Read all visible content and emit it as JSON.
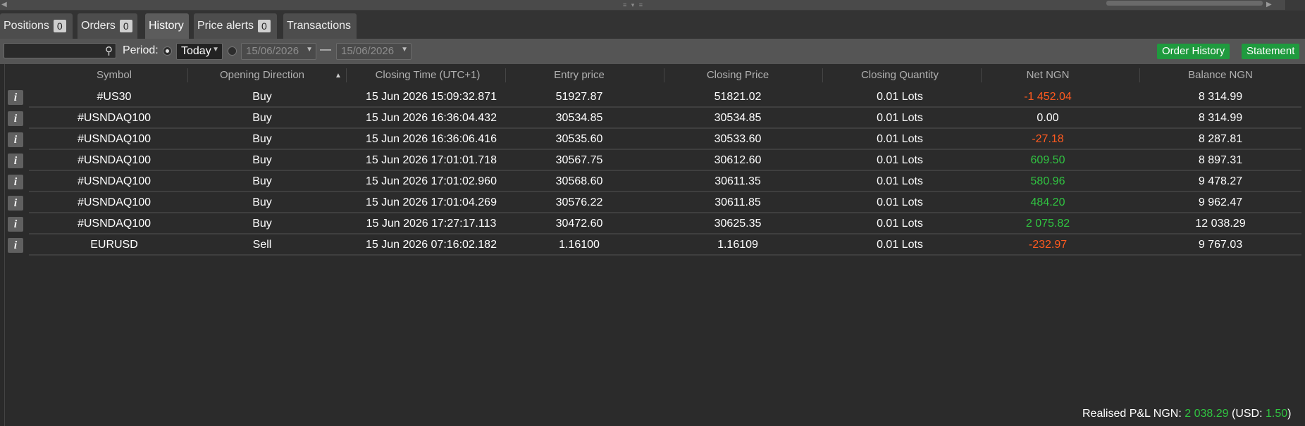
{
  "tabs": [
    {
      "label": "Positions",
      "count": "0"
    },
    {
      "label": "Orders",
      "count": "0"
    },
    {
      "label": "History"
    },
    {
      "label": "Price alerts",
      "count": "0"
    },
    {
      "label": "Transactions"
    }
  ],
  "active_tab": "History",
  "toolbar": {
    "search_placeholder": "",
    "period_label": "Period:",
    "period_value": "Today",
    "date_from": "15/06/2026",
    "date_separator": "—",
    "date_to": "15/06/2026",
    "order_history_label": "Order History",
    "statement_label": "Statement"
  },
  "table": {
    "columns": [
      "Symbol",
      "Opening Direction",
      "Closing Time (UTC+1)",
      "Entry price",
      "Closing Price",
      "Closing Quantity",
      "Net NGN",
      "Balance NGN"
    ],
    "sorted_column": "Opening Direction",
    "rows": [
      {
        "symbol": "#US30",
        "direction": "Buy",
        "closing_time": "15 Jun 2026 15:09:32.871",
        "entry": "51927.87",
        "closing": "51821.02",
        "quantity": "0.01 Lots",
        "net": "-1 452.04",
        "net_sign": "neg",
        "balance": "8 314.99"
      },
      {
        "symbol": "#USNDAQ100",
        "direction": "Buy",
        "closing_time": "15 Jun 2026 16:36:04.432",
        "entry": "30534.85",
        "closing": "30534.85",
        "quantity": "0.01 Lots",
        "net": "0.00",
        "net_sign": "zero",
        "balance": "8 314.99"
      },
      {
        "symbol": "#USNDAQ100",
        "direction": "Buy",
        "closing_time": "15 Jun 2026 16:36:06.416",
        "entry": "30535.60",
        "closing": "30533.60",
        "quantity": "0.01 Lots",
        "net": "-27.18",
        "net_sign": "neg",
        "balance": "8 287.81"
      },
      {
        "symbol": "#USNDAQ100",
        "direction": "Buy",
        "closing_time": "15 Jun 2026 17:01:01.718",
        "entry": "30567.75",
        "closing": "30612.60",
        "quantity": "0.01 Lots",
        "net": "609.50",
        "net_sign": "pos",
        "balance": "8 897.31"
      },
      {
        "symbol": "#USNDAQ100",
        "direction": "Buy",
        "closing_time": "15 Jun 2026 17:01:02.960",
        "entry": "30568.60",
        "closing": "30611.35",
        "quantity": "0.01 Lots",
        "net": "580.96",
        "net_sign": "pos",
        "balance": "9 478.27"
      },
      {
        "symbol": "#USNDAQ100",
        "direction": "Buy",
        "closing_time": "15 Jun 2026 17:01:04.269",
        "entry": "30576.22",
        "closing": "30611.85",
        "quantity": "0.01 Lots",
        "net": "484.20",
        "net_sign": "pos",
        "balance": "9 962.47"
      },
      {
        "symbol": "#USNDAQ100",
        "direction": "Buy",
        "closing_time": "15 Jun 2026 17:27:17.113",
        "entry": "30472.60",
        "closing": "30625.35",
        "quantity": "0.01 Lots",
        "net": "2 075.82",
        "net_sign": "pos",
        "balance": "12 038.29"
      },
      {
        "symbol": "EURUSD",
        "direction": "Sell",
        "closing_time": "15 Jun 2026 07:16:02.182",
        "entry": "1.16100",
        "closing": "1.16109",
        "quantity": "0.01 Lots",
        "net": "-232.97",
        "net_sign": "neg",
        "balance": "9 767.03"
      }
    ],
    "info_glyph": "i"
  },
  "footer": {
    "realised_label": "Realised P&L NGN:",
    "realised_value": "2 038.29",
    "usd_open": "(USD:",
    "usd_value": "1.50",
    "usd_close": ")"
  },
  "colors": {
    "positive": "#30c441",
    "negative": "#ff5a1f",
    "button_green": "#1f9a3e"
  },
  "icons": {
    "search": "search-icon",
    "info": "info-icon",
    "dropdown": "chevron-down-icon"
  }
}
